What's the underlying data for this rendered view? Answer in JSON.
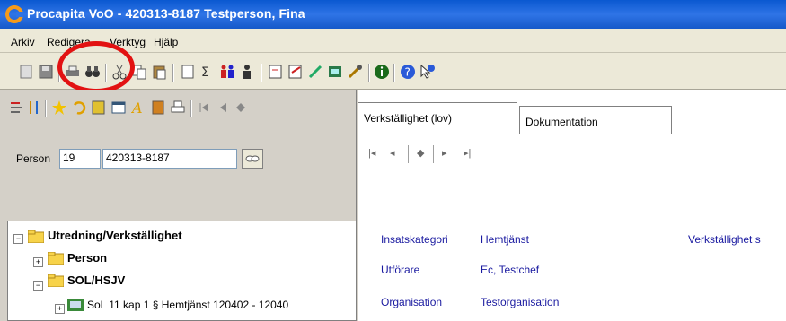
{
  "window": {
    "title": "Procapita VoO - 420313-8187 Testperson, Fina"
  },
  "menu": [
    "Arkiv",
    "Redigera",
    "Verktyg",
    "Hjälp"
  ],
  "toolbar_icons": [
    "new-icon",
    "save-icon",
    "print-icon",
    "binoculars-icon",
    "cut-icon",
    "copy-icon",
    "paste-icon",
    "document-icon",
    "sum-icon",
    "persons-icon",
    "person-icon",
    "report-icon",
    "report-edit-icon",
    "pen-icon",
    "tools-icon",
    "brush-icon",
    "info-icon",
    "help-icon",
    "whats-this-icon"
  ],
  "left_toolbar_icons": [
    "tree-icon",
    "sort-icon",
    "star-icon",
    "undo-icon",
    "note-icon",
    "window-icon",
    "font-icon",
    "book-icon",
    "print-small-icon",
    "first-icon",
    "prev-icon",
    "bookmark-icon"
  ],
  "person": {
    "label": "Person",
    "century": "19",
    "number": "420313-8187"
  },
  "tree": {
    "root": "Utredning/Verkställighet",
    "children": [
      {
        "label": "Person",
        "expander": "+"
      },
      {
        "label": "SOL/HSJV",
        "expander": "−"
      }
    ],
    "leaf": "SoL 11 kap 1 § Hemtjänst 120402 - 12040"
  },
  "tabs": [
    "Verkställighet (lov)",
    "Dokumentation"
  ],
  "nav_buttons": [
    "|◂",
    "◂",
    "◆",
    "▸",
    "▸|"
  ],
  "details": [
    {
      "label": "Insatskategori",
      "value": "Hemtjänst"
    },
    {
      "label": "Utförare",
      "value": "Ec, Testchef"
    },
    {
      "label": "Organisation",
      "value": "Testorganisation"
    }
  ],
  "right_label": "Verkställighet s",
  "colors": {
    "title_bar": "#0a58d0",
    "highlight_circle": "#e21212",
    "label_text": "#1a1aa0"
  }
}
